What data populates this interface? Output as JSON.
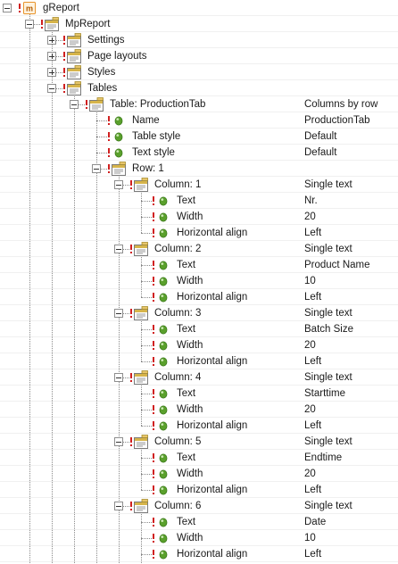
{
  "tree": [
    {
      "label": "gReport",
      "icon": "app-icon",
      "depth": 0,
      "toggle": "minus",
      "value": ""
    },
    {
      "label": "MpReport",
      "icon": "form-icon",
      "depth": 1,
      "toggle": "minus",
      "value": ""
    },
    {
      "label": "Settings",
      "icon": "form-icon",
      "depth": 2,
      "toggle": "plus",
      "value": ""
    },
    {
      "label": "Page layouts",
      "icon": "form-icon",
      "depth": 2,
      "toggle": "plus",
      "value": ""
    },
    {
      "label": "Styles",
      "icon": "form-icon",
      "depth": 2,
      "toggle": "plus",
      "value": ""
    },
    {
      "label": "Tables",
      "icon": "form-icon",
      "depth": 2,
      "toggle": "minus",
      "value": ""
    },
    {
      "label": "Table: ProductionTab",
      "icon": "form-icon",
      "depth": 3,
      "toggle": "minus",
      "value": "Columns by row"
    },
    {
      "label": "Name",
      "icon": "property-icon",
      "depth": 4,
      "toggle": "",
      "value": "ProductionTab"
    },
    {
      "label": "Table style",
      "icon": "property-icon",
      "depth": 4,
      "toggle": "",
      "value": "Default"
    },
    {
      "label": "Text style",
      "icon": "property-icon",
      "depth": 4,
      "toggle": "",
      "value": "Default"
    },
    {
      "label": "Row: 1",
      "icon": "form-icon",
      "depth": 4,
      "toggle": "minus",
      "value": ""
    },
    {
      "label": "Column: 1",
      "icon": "form-icon",
      "depth": 5,
      "toggle": "minus",
      "value": "Single text"
    },
    {
      "label": "Text",
      "icon": "property-icon",
      "depth": 6,
      "toggle": "",
      "value": "Nr."
    },
    {
      "label": "Width",
      "icon": "property-icon",
      "depth": 6,
      "toggle": "",
      "value": "20"
    },
    {
      "label": "Horizontal align",
      "icon": "property-icon",
      "depth": 6,
      "toggle": "",
      "value": "Left"
    },
    {
      "label": "Column: 2",
      "icon": "form-icon",
      "depth": 5,
      "toggle": "minus",
      "value": "Single text"
    },
    {
      "label": "Text",
      "icon": "property-icon",
      "depth": 6,
      "toggle": "",
      "value": "Product Name"
    },
    {
      "label": "Width",
      "icon": "property-icon",
      "depth": 6,
      "toggle": "",
      "value": "10"
    },
    {
      "label": "Horizontal align",
      "icon": "property-icon",
      "depth": 6,
      "toggle": "",
      "value": "Left"
    },
    {
      "label": "Column: 3",
      "icon": "form-icon",
      "depth": 5,
      "toggle": "minus",
      "value": "Single text"
    },
    {
      "label": "Text",
      "icon": "property-icon",
      "depth": 6,
      "toggle": "",
      "value": "Batch Size"
    },
    {
      "label": "Width",
      "icon": "property-icon",
      "depth": 6,
      "toggle": "",
      "value": "20"
    },
    {
      "label": "Horizontal align",
      "icon": "property-icon",
      "depth": 6,
      "toggle": "",
      "value": "Left"
    },
    {
      "label": "Column: 4",
      "icon": "form-icon",
      "depth": 5,
      "toggle": "minus",
      "value": "Single text"
    },
    {
      "label": "Text",
      "icon": "property-icon",
      "depth": 6,
      "toggle": "",
      "value": "Starttime"
    },
    {
      "label": "Width",
      "icon": "property-icon",
      "depth": 6,
      "toggle": "",
      "value": "20"
    },
    {
      "label": "Horizontal align",
      "icon": "property-icon",
      "depth": 6,
      "toggle": "",
      "value": "Left"
    },
    {
      "label": "Column: 5",
      "icon": "form-icon",
      "depth": 5,
      "toggle": "minus",
      "value": "Single text"
    },
    {
      "label": "Text",
      "icon": "property-icon",
      "depth": 6,
      "toggle": "",
      "value": "Endtime"
    },
    {
      "label": "Width",
      "icon": "property-icon",
      "depth": 6,
      "toggle": "",
      "value": "20"
    },
    {
      "label": "Horizontal align",
      "icon": "property-icon",
      "depth": 6,
      "toggle": "",
      "value": "Left"
    },
    {
      "label": "Column: 6",
      "icon": "form-icon",
      "depth": 5,
      "toggle": "minus",
      "value": "Single text"
    },
    {
      "label": "Text",
      "icon": "property-icon",
      "depth": 6,
      "toggle": "",
      "value": "Date"
    },
    {
      "label": "Width",
      "icon": "property-icon",
      "depth": 6,
      "toggle": "",
      "value": "10"
    },
    {
      "label": "Horizontal align",
      "icon": "property-icon",
      "depth": 6,
      "toggle": "",
      "value": "Left"
    }
  ],
  "colors": {
    "required_marker": "#d02020",
    "property_dot": "#5aa02c",
    "app_icon": "#e8932a",
    "form_icon_header": "#d6b44a"
  }
}
